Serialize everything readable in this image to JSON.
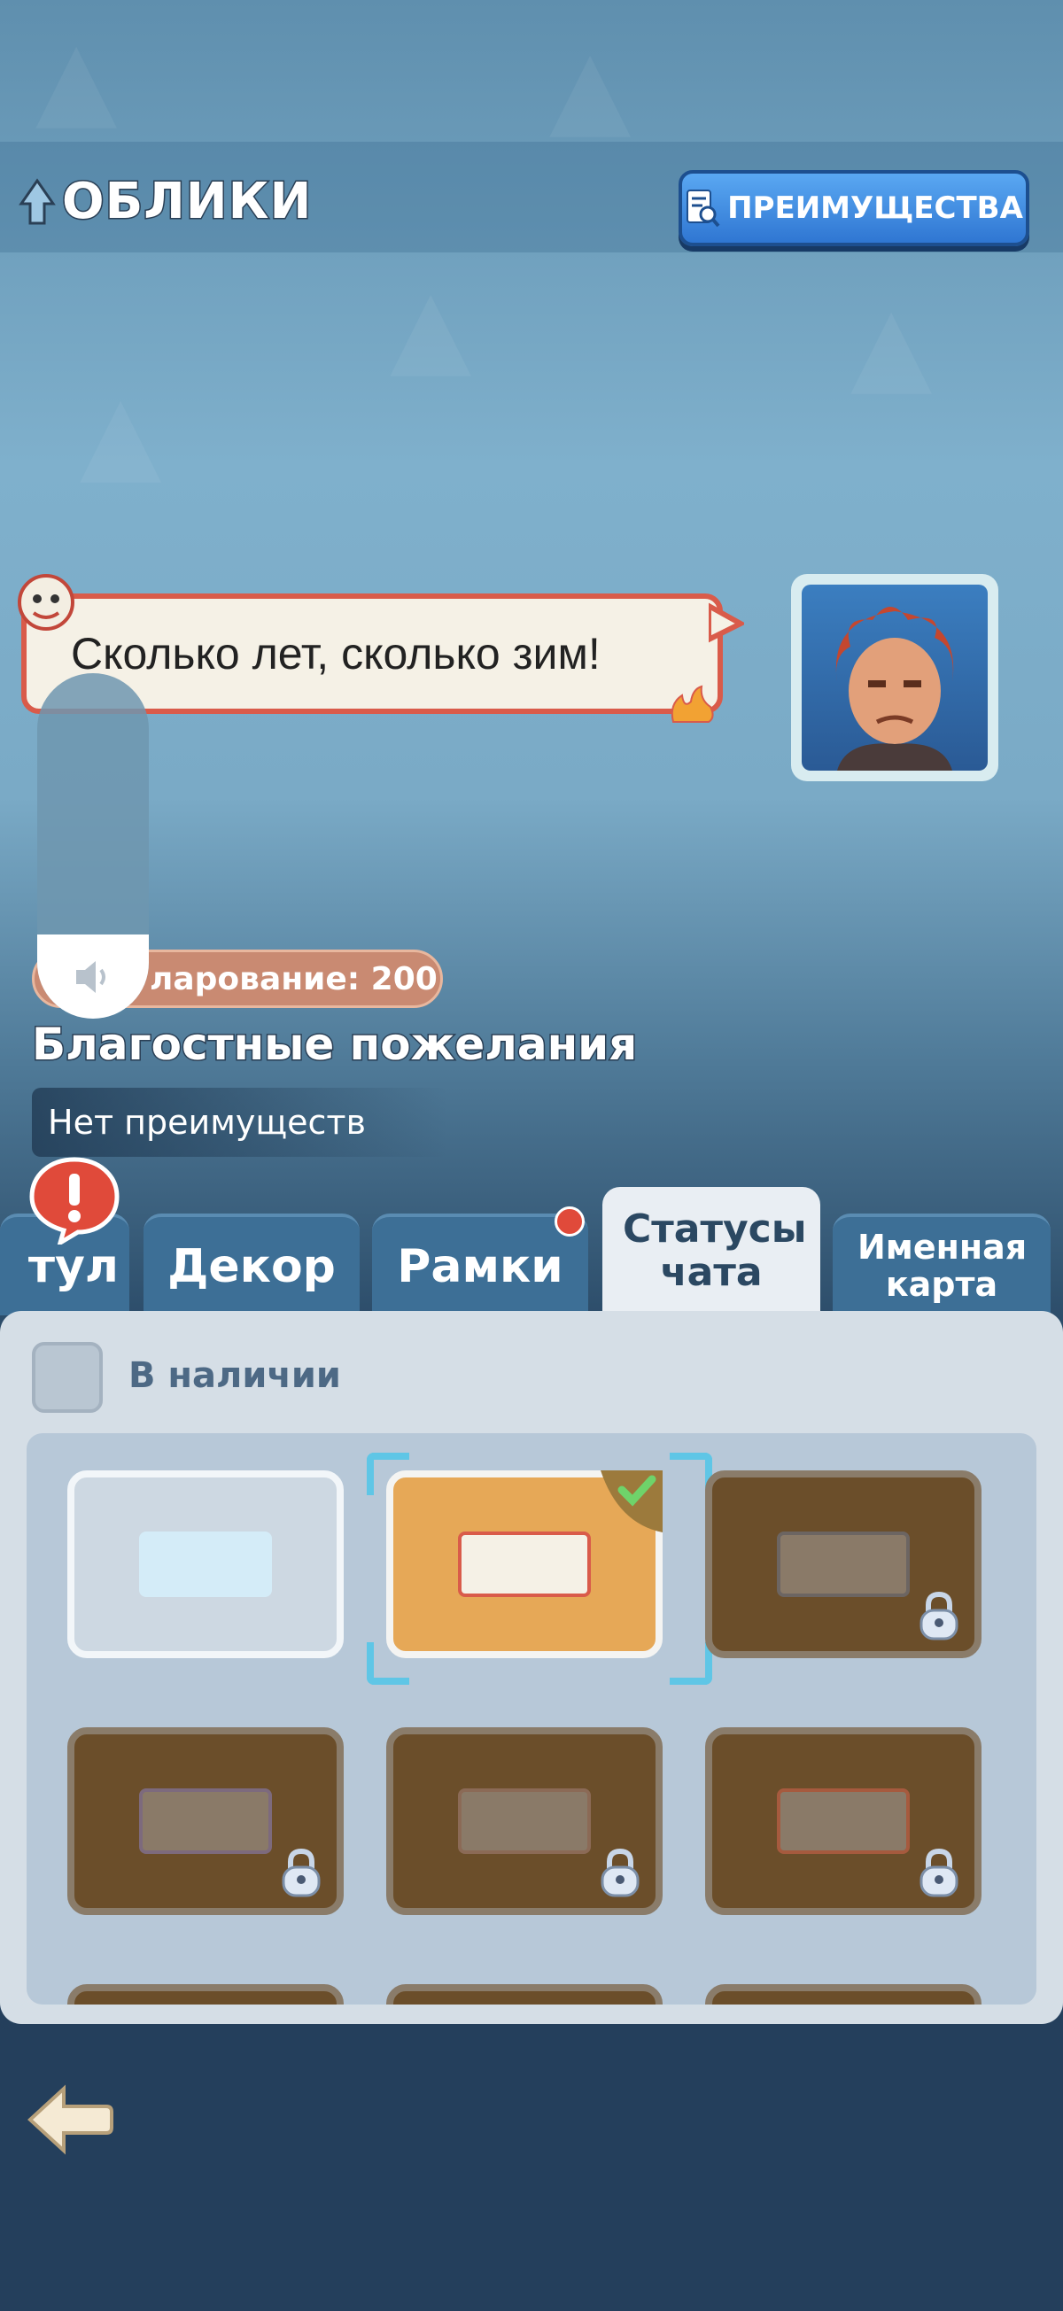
{
  "header": {
    "title": "ОБЛИКИ",
    "benefits_button": "ПРЕИМУЩЕСТВА"
  },
  "preview": {
    "speech_text": "Сколько лет, сколько зим!",
    "collect_label": "ларование: 200",
    "skin_name": "Благостные пожелания",
    "benefit_text": "Нет преимуществ"
  },
  "tabs": [
    {
      "label": "тул",
      "active": false
    },
    {
      "label": "Декор",
      "active": false
    },
    {
      "label": "Рамки",
      "active": false,
      "has_notification": true
    },
    {
      "label": "Статусы чата",
      "active": true
    },
    {
      "label": "Именная карта",
      "active": false
    }
  ],
  "filter": {
    "available_label": "В наличии",
    "checked": false
  },
  "items": [
    {
      "state": "default",
      "locked": false
    },
    {
      "state": "selected",
      "locked": false,
      "equipped": true
    },
    {
      "state": "locked",
      "locked": true
    },
    {
      "state": "locked",
      "locked": true
    },
    {
      "state": "locked",
      "locked": true
    },
    {
      "state": "locked",
      "locked": true
    }
  ],
  "colors": {
    "accent_blue": "#2f76d2",
    "bubble_border": "#d95b4a",
    "locked_cell": "#6b4e2a",
    "selected_cell": "#e6a857",
    "notification": "#e04a3a"
  }
}
